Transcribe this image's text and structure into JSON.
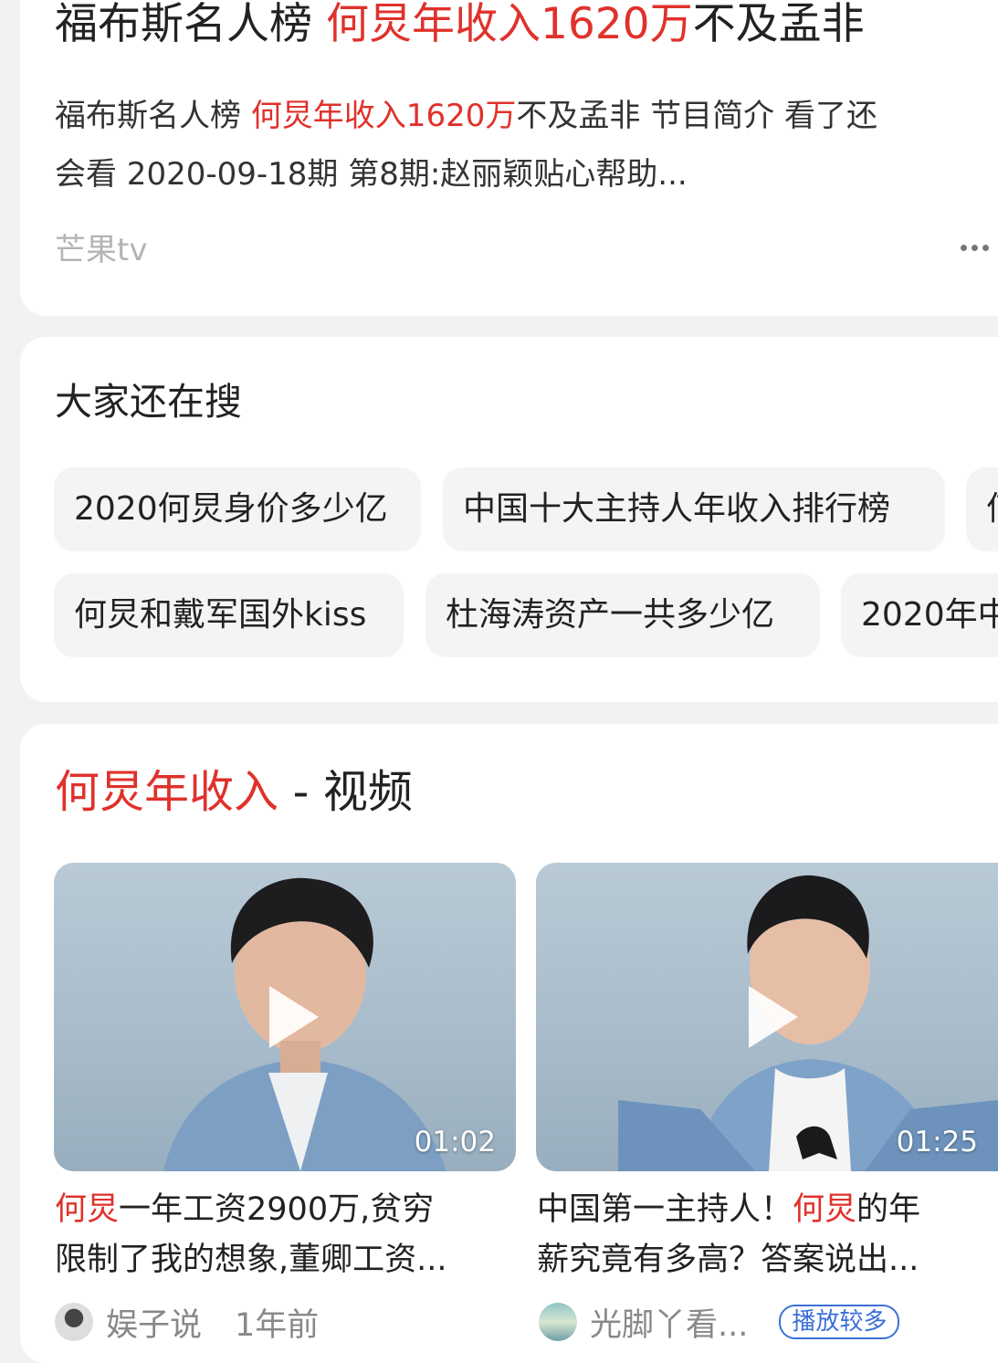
{
  "result": {
    "title_prefix": "福布斯名人榜 ",
    "title_highlight": "何炅年收入1620万",
    "title_suffix": "不及孟非",
    "desc_line1_prefix": "福布斯名人榜 ",
    "desc_line1_highlight": "何炅年收入1620万",
    "desc_line1_suffix": "不及孟非 节目简介 看了还",
    "desc_line2": "会看 2020-09-18期 第8期:赵丽颖贴心帮助...",
    "source": "芒果tv",
    "more_icon": "more-icon"
  },
  "related": {
    "title": "大家还在搜",
    "row1": [
      "2020何炅身价多少亿",
      "中国十大主持人年收入排行榜",
      "何"
    ],
    "row2": [
      "何炅和戴军国外kiss",
      "杜海涛资产一共多少亿",
      "2020年中"
    ]
  },
  "videos": {
    "section_highlight": "何炅年收入",
    "section_suffix": " - 视频",
    "items": [
      {
        "duration": "01:02",
        "title_highlight": "何炅",
        "title_line1_rest": "一年工资2900万,贫穷",
        "title_line2": "限制了我的想象,董卿工资...",
        "author": "娱子说",
        "time": "1年前"
      },
      {
        "duration": "01:25",
        "title_line1_pre": "中国第一主持人！",
        "title_highlight": "何炅",
        "title_line1_post": "的年",
        "title_line2": "薪究竟有多高？答案说出...",
        "author": "光脚丫看...",
        "badge": "播放较多"
      }
    ]
  },
  "colors": {
    "highlight": "#e0312b",
    "badge": "#3b6fd8"
  }
}
